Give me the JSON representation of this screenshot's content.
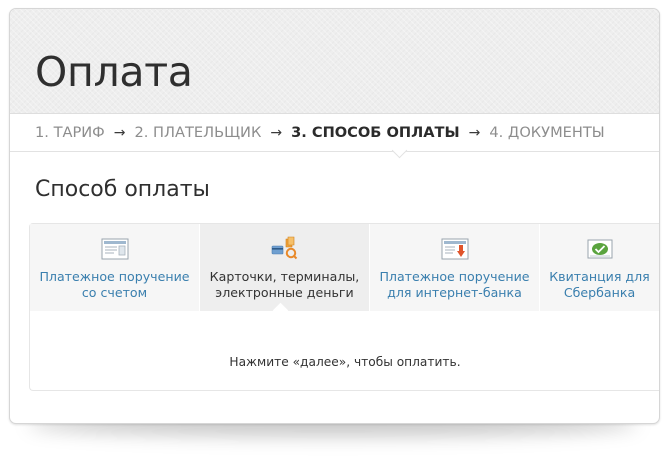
{
  "page": {
    "title": "Оплата"
  },
  "steps": [
    {
      "label": "1. ТАРИФ",
      "active": false
    },
    {
      "label": "2. ПЛАТЕЛЬЩИК",
      "active": false
    },
    {
      "label": "3. СПОСОБ ОПЛАТЫ",
      "active": true
    },
    {
      "label": "4. ДОКУМЕНТЫ",
      "active": false
    }
  ],
  "step_separator": "→",
  "section": {
    "title": "Способ оплаты"
  },
  "methods": [
    {
      "line1": "Платежное поручение",
      "line2": "со счетом",
      "icon": "invoice-document-icon",
      "selected": false
    },
    {
      "line1": "Карточки, терминалы,",
      "line2": "электронные деньги",
      "icon": "cards-terminals-icon",
      "selected": true
    },
    {
      "line1": "Платежное поручение",
      "line2": "для интернет-банка",
      "icon": "internet-bank-document-icon",
      "selected": false
    },
    {
      "line1": "Квитанция для",
      "line2": "Сбербанка",
      "icon": "sberbank-receipt-icon",
      "selected": false
    }
  ],
  "hint": "Нажмите «далее», чтобы оплатить.",
  "colors": {
    "link": "#3a7fae",
    "text": "#2f2f2f",
    "muted": "#8d8d8d",
    "tab_bg": "#f6f6f6",
    "tab_selected_bg": "#eeeeee"
  }
}
